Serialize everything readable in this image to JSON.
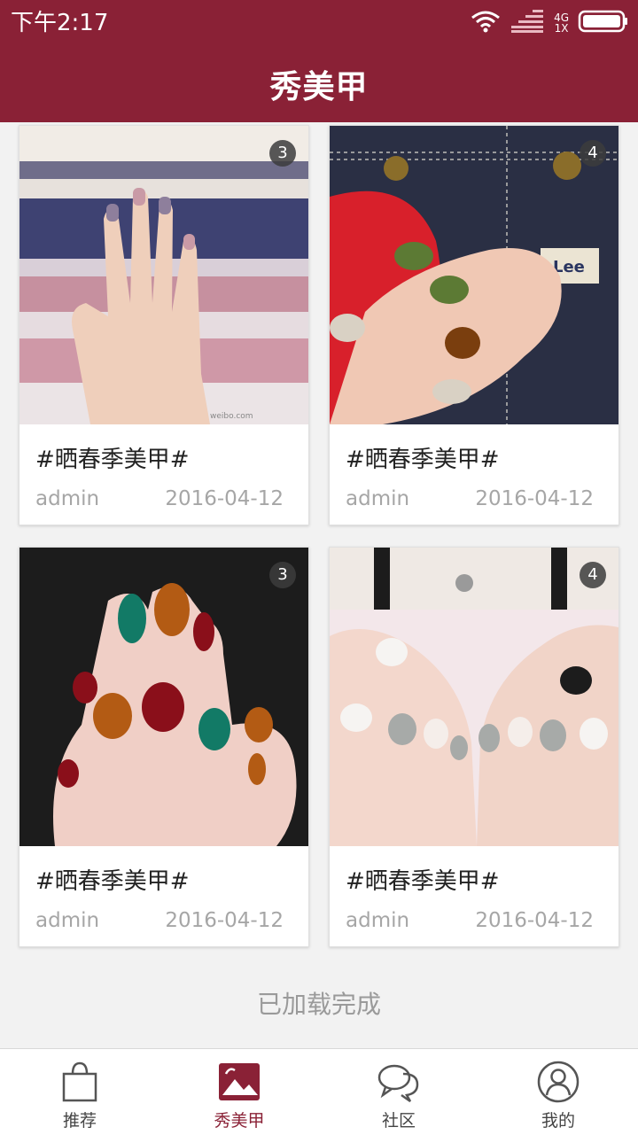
{
  "status_bar": {
    "time": "下午2:17",
    "network_top": "4G",
    "network_bottom": "1X"
  },
  "header": {
    "title": "秀美甲"
  },
  "colors": {
    "brand": "#8a2136",
    "muted_text": "#a6a6a6"
  },
  "posts": [
    {
      "title": "#晒春季美甲#",
      "author": "admin",
      "date": "2016-04-12",
      "image_count": "3"
    },
    {
      "title": "#晒春季美甲#",
      "author": "admin",
      "date": "2016-04-12",
      "image_count": "4"
    },
    {
      "title": "#晒春季美甲#",
      "author": "admin",
      "date": "2016-04-12",
      "image_count": "3"
    },
    {
      "title": "#晒春季美甲#",
      "author": "admin",
      "date": "2016-04-12",
      "image_count": "4"
    }
  ],
  "feed_status": "已加载完成",
  "tab_bar": {
    "tabs": [
      {
        "label": "推荐",
        "icon": "shopping-bag-icon"
      },
      {
        "label": "秀美甲",
        "icon": "picture-icon"
      },
      {
        "label": "社区",
        "icon": "chat-bubbles-icon"
      },
      {
        "label": "我的",
        "icon": "user-icon"
      }
    ],
    "active_tab": "秀美甲"
  }
}
